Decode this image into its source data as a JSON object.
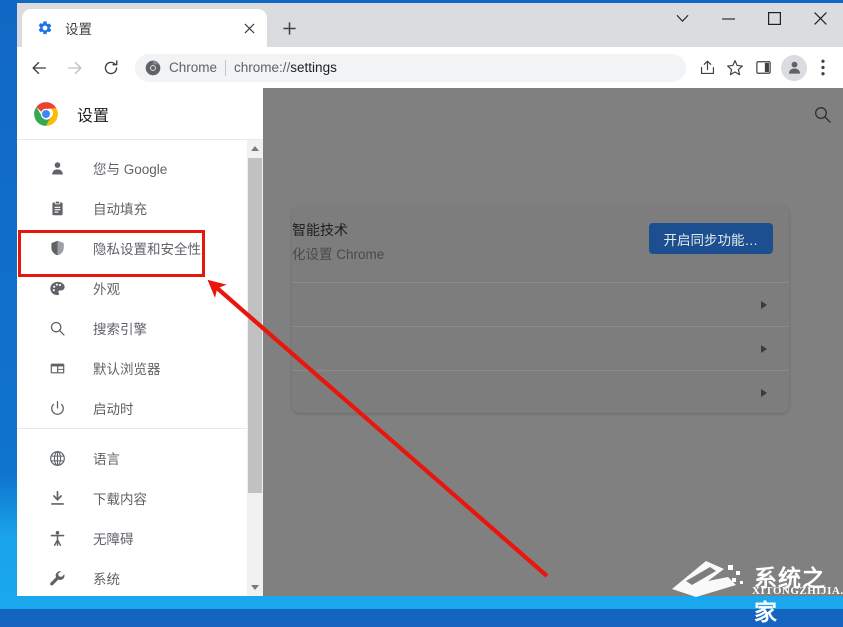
{
  "window": {
    "caption_buttons": [
      {
        "name": "tab-search",
        "glyph": "⌄",
        "label": "Tab search"
      },
      {
        "name": "minimize",
        "glyph": "—",
        "label": "Minimize"
      },
      {
        "name": "maximize",
        "glyph": "□",
        "label": "Maximize"
      },
      {
        "name": "close",
        "glyph": "✕",
        "label": "Close"
      }
    ]
  },
  "tabs": {
    "active": {
      "title": "设置",
      "favicon": "gear-icon",
      "close_label": "✕"
    },
    "new_tab_label": "+"
  },
  "toolbar": {
    "back_label": "←",
    "forward_label": "→",
    "reload_label": "⟳",
    "omnibox": {
      "chip_icon": "chrome-logo-icon",
      "chip_label": "Chrome",
      "separator": "|",
      "url_scheme": "chrome://",
      "url_path": "settings",
      "url_full": "chrome://settings"
    },
    "actions": [
      {
        "name": "share-icon",
        "label": "分享"
      },
      {
        "name": "bookmark-star-icon",
        "label": "收藏"
      },
      {
        "name": "side-panel-icon",
        "label": "侧边栏"
      },
      {
        "name": "profile-avatar-icon",
        "label": "个人资料"
      },
      {
        "name": "three-dot-menu-icon",
        "label": "更多"
      }
    ]
  },
  "settings": {
    "header": {
      "logo": "chrome-logo-icon",
      "title": "设置"
    },
    "search_icon": "search-icon",
    "menu_groups": [
      {
        "items": [
          {
            "icon": "person-icon",
            "label": "您与 Google",
            "highlighted": false
          },
          {
            "icon": "clipboard-icon",
            "label": "自动填充",
            "highlighted": false
          },
          {
            "icon": "shield-icon",
            "label": "隐私设置和安全性",
            "highlighted": true
          },
          {
            "icon": "palette-icon",
            "label": "外观",
            "highlighted": false
          },
          {
            "icon": "search-icon",
            "label": "搜索引擎",
            "highlighted": false
          },
          {
            "icon": "browser-window-icon",
            "label": "默认浏览器",
            "highlighted": false
          },
          {
            "icon": "power-icon",
            "label": "启动时",
            "highlighted": false
          }
        ]
      },
      {
        "items": [
          {
            "icon": "globe-icon",
            "label": "语言",
            "highlighted": false
          },
          {
            "icon": "download-icon",
            "label": "下载内容",
            "highlighted": false
          },
          {
            "icon": "accessibility-icon",
            "label": "无障碍",
            "highlighted": false
          },
          {
            "icon": "wrench-icon",
            "label": "系统",
            "highlighted": false
          }
        ]
      }
    ],
    "scrollbar": {
      "up_arrow": "▲",
      "down_arrow": "▼"
    }
  },
  "main_card": {
    "sync_row": {
      "title_visible": "智能技术",
      "subtitle_visible": "化设置 Chrome",
      "button_label": "开启同步功能…"
    },
    "rows": [
      {
        "arrow": "chevron-right-icon"
      },
      {
        "arrow": "chevron-right-icon"
      },
      {
        "arrow": "chevron-right-icon"
      }
    ]
  },
  "annotation": {
    "box_color": "#e8170e",
    "arrow_color": "#e8170e",
    "target_label": "隐私设置和安全性"
  },
  "watermark": {
    "title": "系统之家",
    "subtitle": "XITONGZHIJIA.NET"
  }
}
